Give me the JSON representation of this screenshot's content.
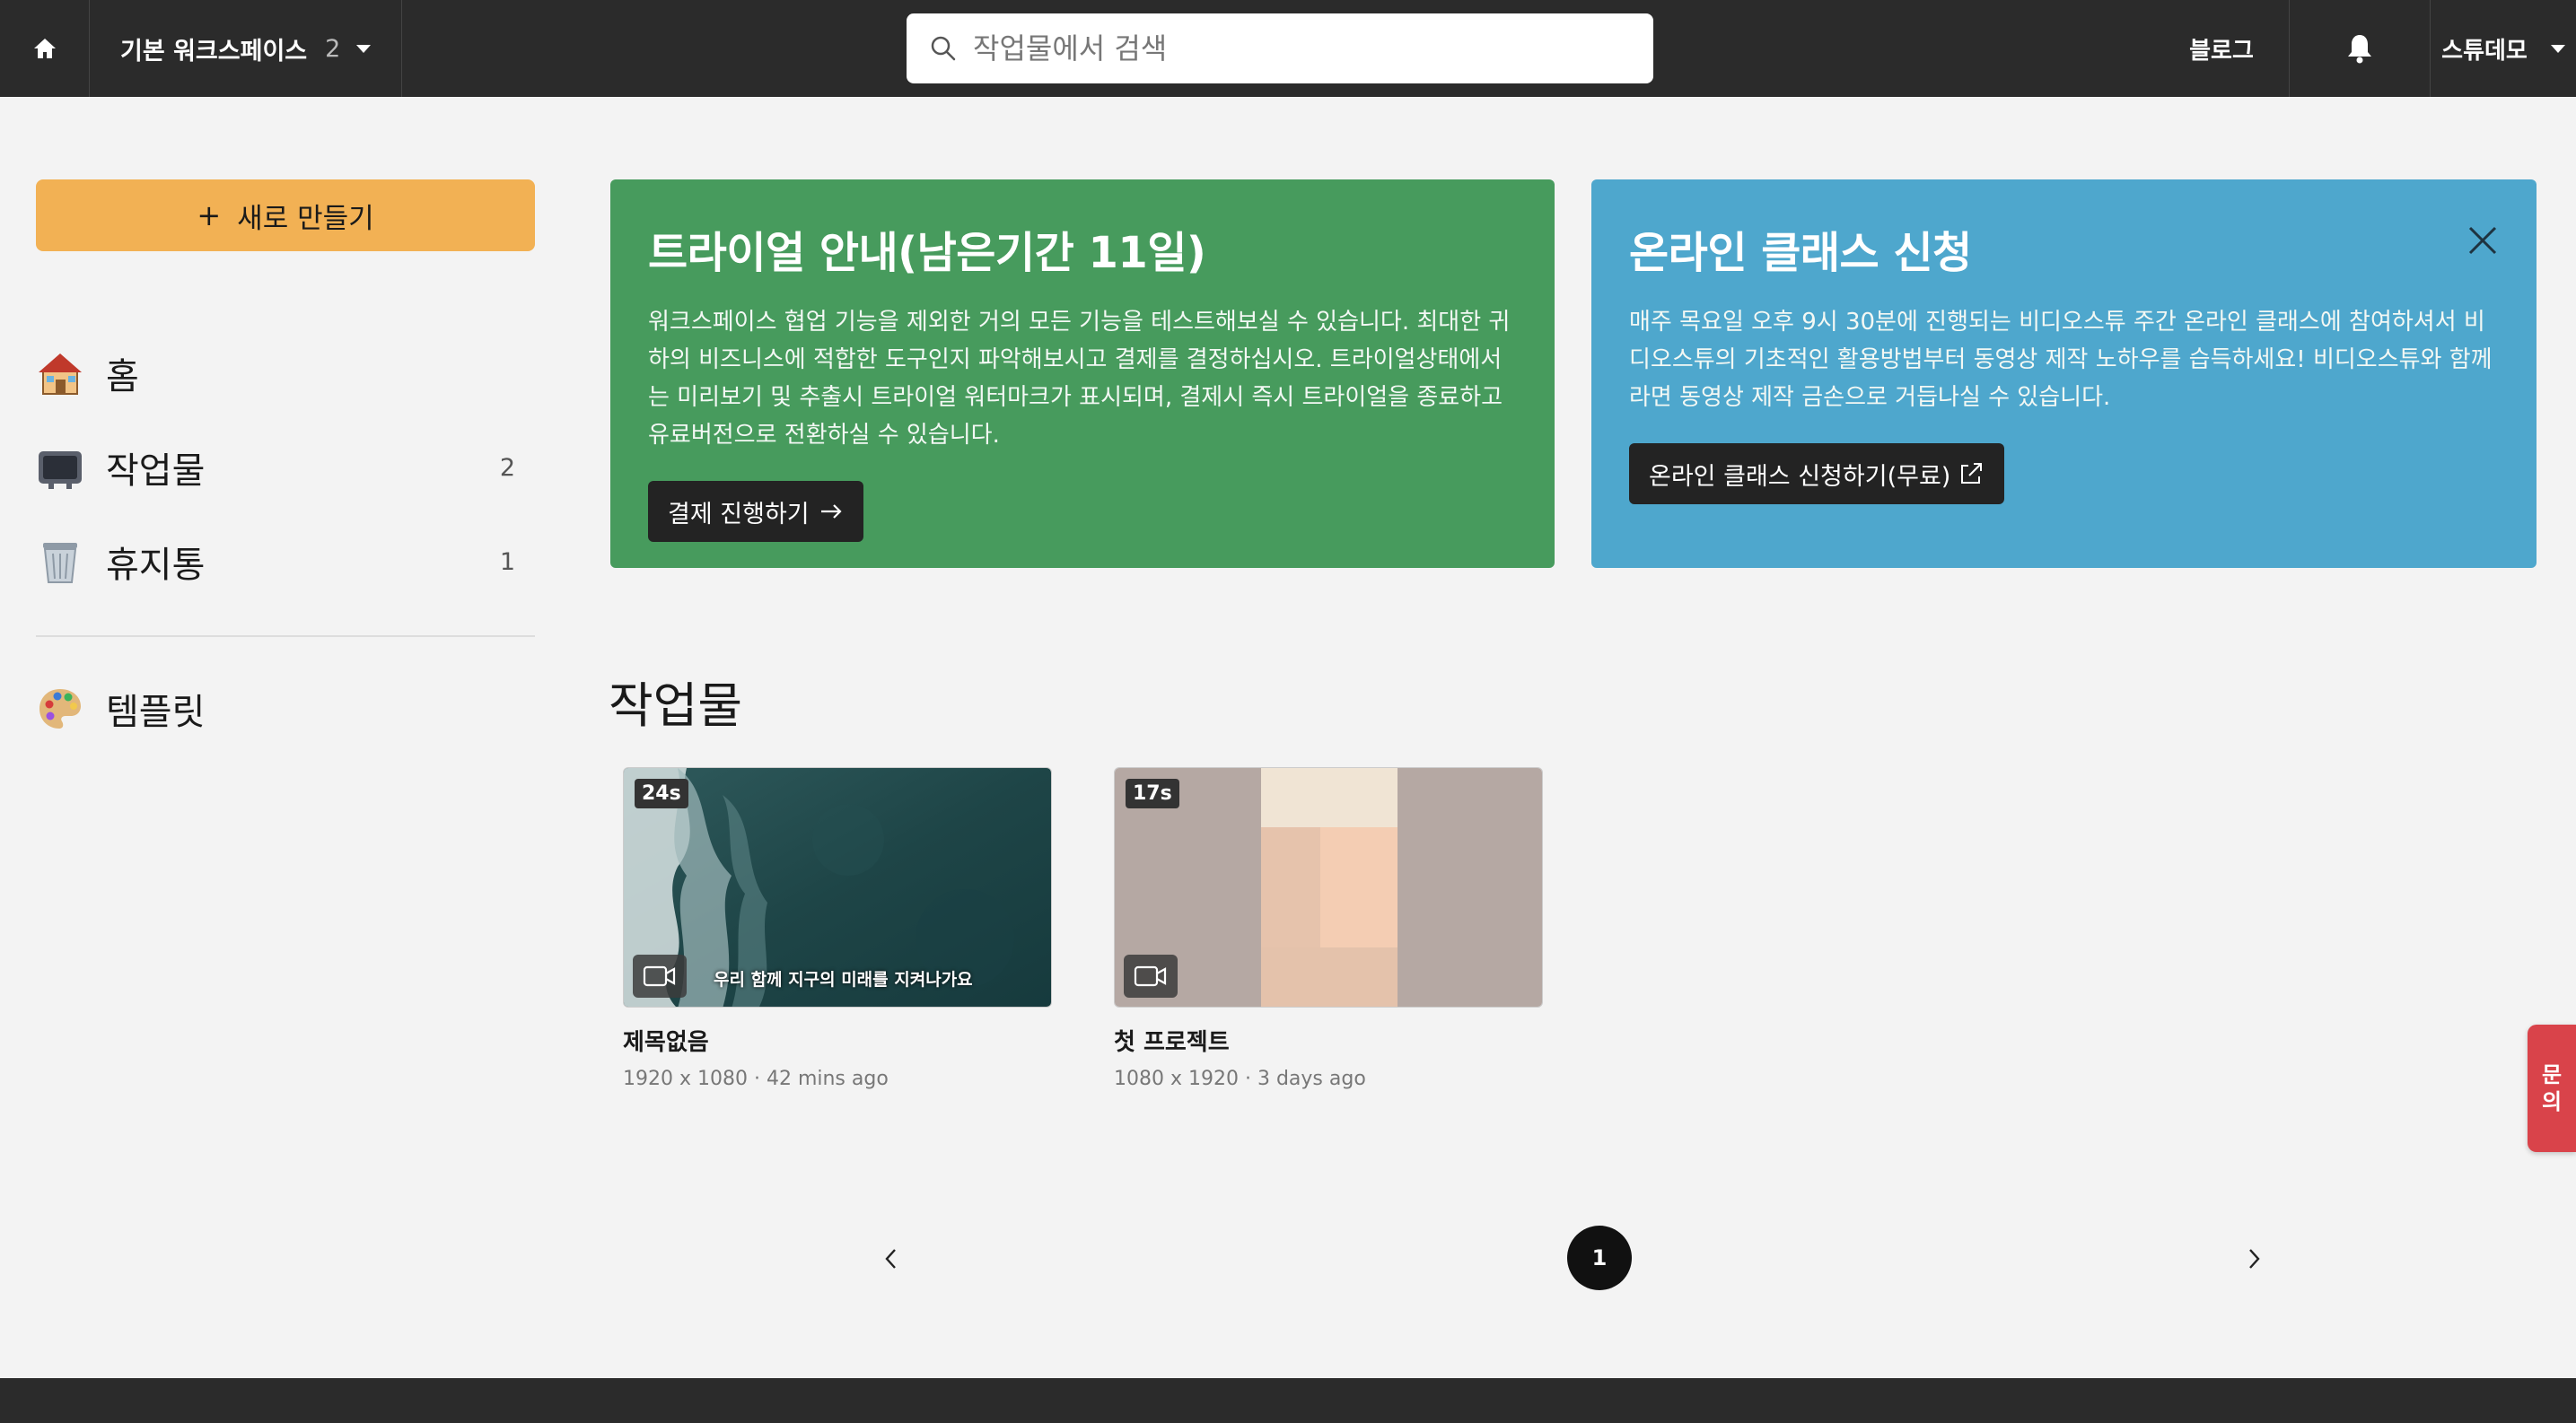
{
  "topbar": {
    "workspace_name": "기본 워크스페이스",
    "workspace_count": "2",
    "search_placeholder": "작업물에서 검색",
    "blog_label": "블로그",
    "user_name": "스튜데모"
  },
  "sidebar": {
    "new_button_label": "새로 만들기",
    "items": [
      {
        "label": "홈",
        "count": "",
        "icon": "house-icon"
      },
      {
        "label": "작업물",
        "count": "2",
        "icon": "television-icon"
      },
      {
        "label": "휴지통",
        "count": "1",
        "icon": "wastebasket-icon"
      },
      {
        "label": "템플릿",
        "count": "",
        "icon": "palette-icon"
      }
    ]
  },
  "banners": {
    "trial": {
      "title": "트라이얼 안내(남은기간 11일)",
      "body": "워크스페이스 협업 기능을 제외한 거의 모든 기능을 테스트해보실 수 있습니다. 최대한 귀하의 비즈니스에 적합한 도구인지 파악해보시고 결제를 결정하십시오. 트라이얼상태에서는 미리보기 및 추출시 트라이얼 워터마크가 표시되며, 결제시 즉시 트라이얼을 종료하고 유료버전으로 전환하실 수 있습니다.",
      "cta_label": "결제 진행하기",
      "color": "#479b5d"
    },
    "class": {
      "title": "온라인 클래스 신청",
      "body": "매주 목요일 오후 9시 30분에 진행되는 비디오스튜 주간 온라인 클래스에 참여하셔서 비디오스튜의 기초적인 활용방법부터 동영상 제작 노하우를 습득하세요! 비디오스튜와 함께라면 동영상 제작 금손으로 거듭나실 수 있습니다.",
      "cta_label": "온라인 클래스 신청하기(무료)",
      "color": "#4ea7cd"
    }
  },
  "works": {
    "section_title": "작업물",
    "items": [
      {
        "title": "제목없음",
        "meta": "1920 x 1080 · 42 mins ago",
        "duration": "24s",
        "subtitle": "우리 함께 지구의 미래를 지켜나가요"
      },
      {
        "title": "첫 프로젝트",
        "meta": "1080 x 1920 · 3 days ago",
        "duration": "17s",
        "subtitle": ""
      }
    ]
  },
  "pagination": {
    "current": "1"
  },
  "inquiry": {
    "line1": "문",
    "line2": "의"
  },
  "accent_color": "#f2b154"
}
